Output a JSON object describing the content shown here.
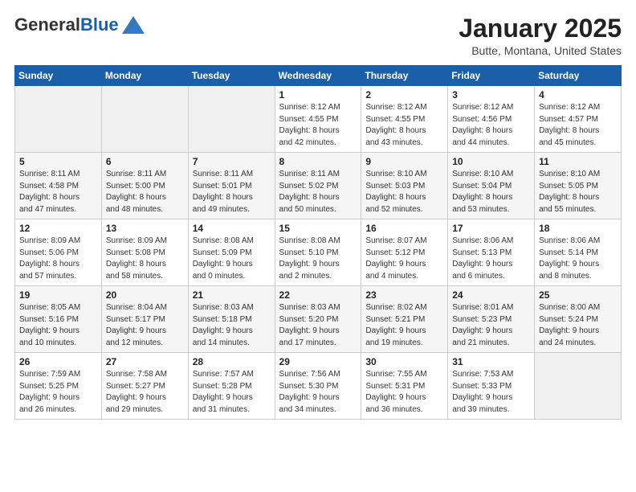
{
  "header": {
    "logo_general": "General",
    "logo_blue": "Blue",
    "month": "January 2025",
    "location": "Butte, Montana, United States"
  },
  "days_of_week": [
    "Sunday",
    "Monday",
    "Tuesday",
    "Wednesday",
    "Thursday",
    "Friday",
    "Saturday"
  ],
  "weeks": [
    [
      {
        "day": "",
        "info": ""
      },
      {
        "day": "",
        "info": ""
      },
      {
        "day": "",
        "info": ""
      },
      {
        "day": "1",
        "info": "Sunrise: 8:12 AM\nSunset: 4:55 PM\nDaylight: 8 hours\nand 42 minutes."
      },
      {
        "day": "2",
        "info": "Sunrise: 8:12 AM\nSunset: 4:55 PM\nDaylight: 8 hours\nand 43 minutes."
      },
      {
        "day": "3",
        "info": "Sunrise: 8:12 AM\nSunset: 4:56 PM\nDaylight: 8 hours\nand 44 minutes."
      },
      {
        "day": "4",
        "info": "Sunrise: 8:12 AM\nSunset: 4:57 PM\nDaylight: 8 hours\nand 45 minutes."
      }
    ],
    [
      {
        "day": "5",
        "info": "Sunrise: 8:11 AM\nSunset: 4:58 PM\nDaylight: 8 hours\nand 47 minutes."
      },
      {
        "day": "6",
        "info": "Sunrise: 8:11 AM\nSunset: 5:00 PM\nDaylight: 8 hours\nand 48 minutes."
      },
      {
        "day": "7",
        "info": "Sunrise: 8:11 AM\nSunset: 5:01 PM\nDaylight: 8 hours\nand 49 minutes."
      },
      {
        "day": "8",
        "info": "Sunrise: 8:11 AM\nSunset: 5:02 PM\nDaylight: 8 hours\nand 50 minutes."
      },
      {
        "day": "9",
        "info": "Sunrise: 8:10 AM\nSunset: 5:03 PM\nDaylight: 8 hours\nand 52 minutes."
      },
      {
        "day": "10",
        "info": "Sunrise: 8:10 AM\nSunset: 5:04 PM\nDaylight: 8 hours\nand 53 minutes."
      },
      {
        "day": "11",
        "info": "Sunrise: 8:10 AM\nSunset: 5:05 PM\nDaylight: 8 hours\nand 55 minutes."
      }
    ],
    [
      {
        "day": "12",
        "info": "Sunrise: 8:09 AM\nSunset: 5:06 PM\nDaylight: 8 hours\nand 57 minutes."
      },
      {
        "day": "13",
        "info": "Sunrise: 8:09 AM\nSunset: 5:08 PM\nDaylight: 8 hours\nand 58 minutes."
      },
      {
        "day": "14",
        "info": "Sunrise: 8:08 AM\nSunset: 5:09 PM\nDaylight: 9 hours\nand 0 minutes."
      },
      {
        "day": "15",
        "info": "Sunrise: 8:08 AM\nSunset: 5:10 PM\nDaylight: 9 hours\nand 2 minutes."
      },
      {
        "day": "16",
        "info": "Sunrise: 8:07 AM\nSunset: 5:12 PM\nDaylight: 9 hours\nand 4 minutes."
      },
      {
        "day": "17",
        "info": "Sunrise: 8:06 AM\nSunset: 5:13 PM\nDaylight: 9 hours\nand 6 minutes."
      },
      {
        "day": "18",
        "info": "Sunrise: 8:06 AM\nSunset: 5:14 PM\nDaylight: 9 hours\nand 8 minutes."
      }
    ],
    [
      {
        "day": "19",
        "info": "Sunrise: 8:05 AM\nSunset: 5:16 PM\nDaylight: 9 hours\nand 10 minutes."
      },
      {
        "day": "20",
        "info": "Sunrise: 8:04 AM\nSunset: 5:17 PM\nDaylight: 9 hours\nand 12 minutes."
      },
      {
        "day": "21",
        "info": "Sunrise: 8:03 AM\nSunset: 5:18 PM\nDaylight: 9 hours\nand 14 minutes."
      },
      {
        "day": "22",
        "info": "Sunrise: 8:03 AM\nSunset: 5:20 PM\nDaylight: 9 hours\nand 17 minutes."
      },
      {
        "day": "23",
        "info": "Sunrise: 8:02 AM\nSunset: 5:21 PM\nDaylight: 9 hours\nand 19 minutes."
      },
      {
        "day": "24",
        "info": "Sunrise: 8:01 AM\nSunset: 5:23 PM\nDaylight: 9 hours\nand 21 minutes."
      },
      {
        "day": "25",
        "info": "Sunrise: 8:00 AM\nSunset: 5:24 PM\nDaylight: 9 hours\nand 24 minutes."
      }
    ],
    [
      {
        "day": "26",
        "info": "Sunrise: 7:59 AM\nSunset: 5:25 PM\nDaylight: 9 hours\nand 26 minutes."
      },
      {
        "day": "27",
        "info": "Sunrise: 7:58 AM\nSunset: 5:27 PM\nDaylight: 9 hours\nand 29 minutes."
      },
      {
        "day": "28",
        "info": "Sunrise: 7:57 AM\nSunset: 5:28 PM\nDaylight: 9 hours\nand 31 minutes."
      },
      {
        "day": "29",
        "info": "Sunrise: 7:56 AM\nSunset: 5:30 PM\nDaylight: 9 hours\nand 34 minutes."
      },
      {
        "day": "30",
        "info": "Sunrise: 7:55 AM\nSunset: 5:31 PM\nDaylight: 9 hours\nand 36 minutes."
      },
      {
        "day": "31",
        "info": "Sunrise: 7:53 AM\nSunset: 5:33 PM\nDaylight: 9 hours\nand 39 minutes."
      },
      {
        "day": "",
        "info": ""
      }
    ]
  ]
}
